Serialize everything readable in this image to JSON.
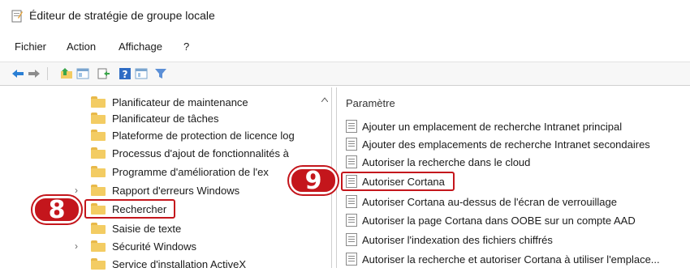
{
  "window": {
    "title": "Éditeur de stratégie de groupe locale"
  },
  "menu": {
    "items": [
      "Fichier",
      "Action",
      "Affichage",
      "?"
    ]
  },
  "toolbar": {
    "icons": [
      "back-arrow-icon",
      "forward-arrow-icon",
      "folder-up-icon",
      "show-hide-tree-icon",
      "export-list-icon",
      "help-icon",
      "properties-icon",
      "filter-icon"
    ]
  },
  "tree": {
    "items": [
      {
        "label": "Planificateur de maintenance",
        "expandable": false
      },
      {
        "label": "Planificateur de tâches",
        "expandable": false
      },
      {
        "label": "Plateforme de protection de licence log",
        "expandable": false
      },
      {
        "label": "Processus d'ajout de fonctionnalités à",
        "expandable": false
      },
      {
        "label": "Programme d'amélioration de l'ex",
        "expandable": false
      },
      {
        "label": "Rapport d'erreurs Windows",
        "expandable": true
      },
      {
        "label": "Rechercher",
        "expandable": false,
        "selected": true
      },
      {
        "label": "Saisie de texte",
        "expandable": false
      },
      {
        "label": "Sécurité Windows",
        "expandable": true
      },
      {
        "label": "Service d'installation ActiveX",
        "expandable": false
      }
    ]
  },
  "settings": {
    "header": "Paramètre",
    "items": [
      "Ajouter un emplacement de recherche Intranet principal",
      "Ajouter des emplacements de recherche Intranet secondaires",
      "Autoriser la recherche dans le cloud",
      "Autoriser Cortana",
      "Autoriser Cortana au-dessus de l'écran de verrouillage",
      "Autoriser la page Cortana dans OOBE sur un compte AAD",
      "Autoriser l'indexation des fichiers chiffrés",
      "Autoriser la recherche et autoriser Cortana à utiliser l'emplace..."
    ]
  },
  "annotations": {
    "badge_left": "8",
    "badge_right": "9",
    "accent": "#c4161c"
  }
}
